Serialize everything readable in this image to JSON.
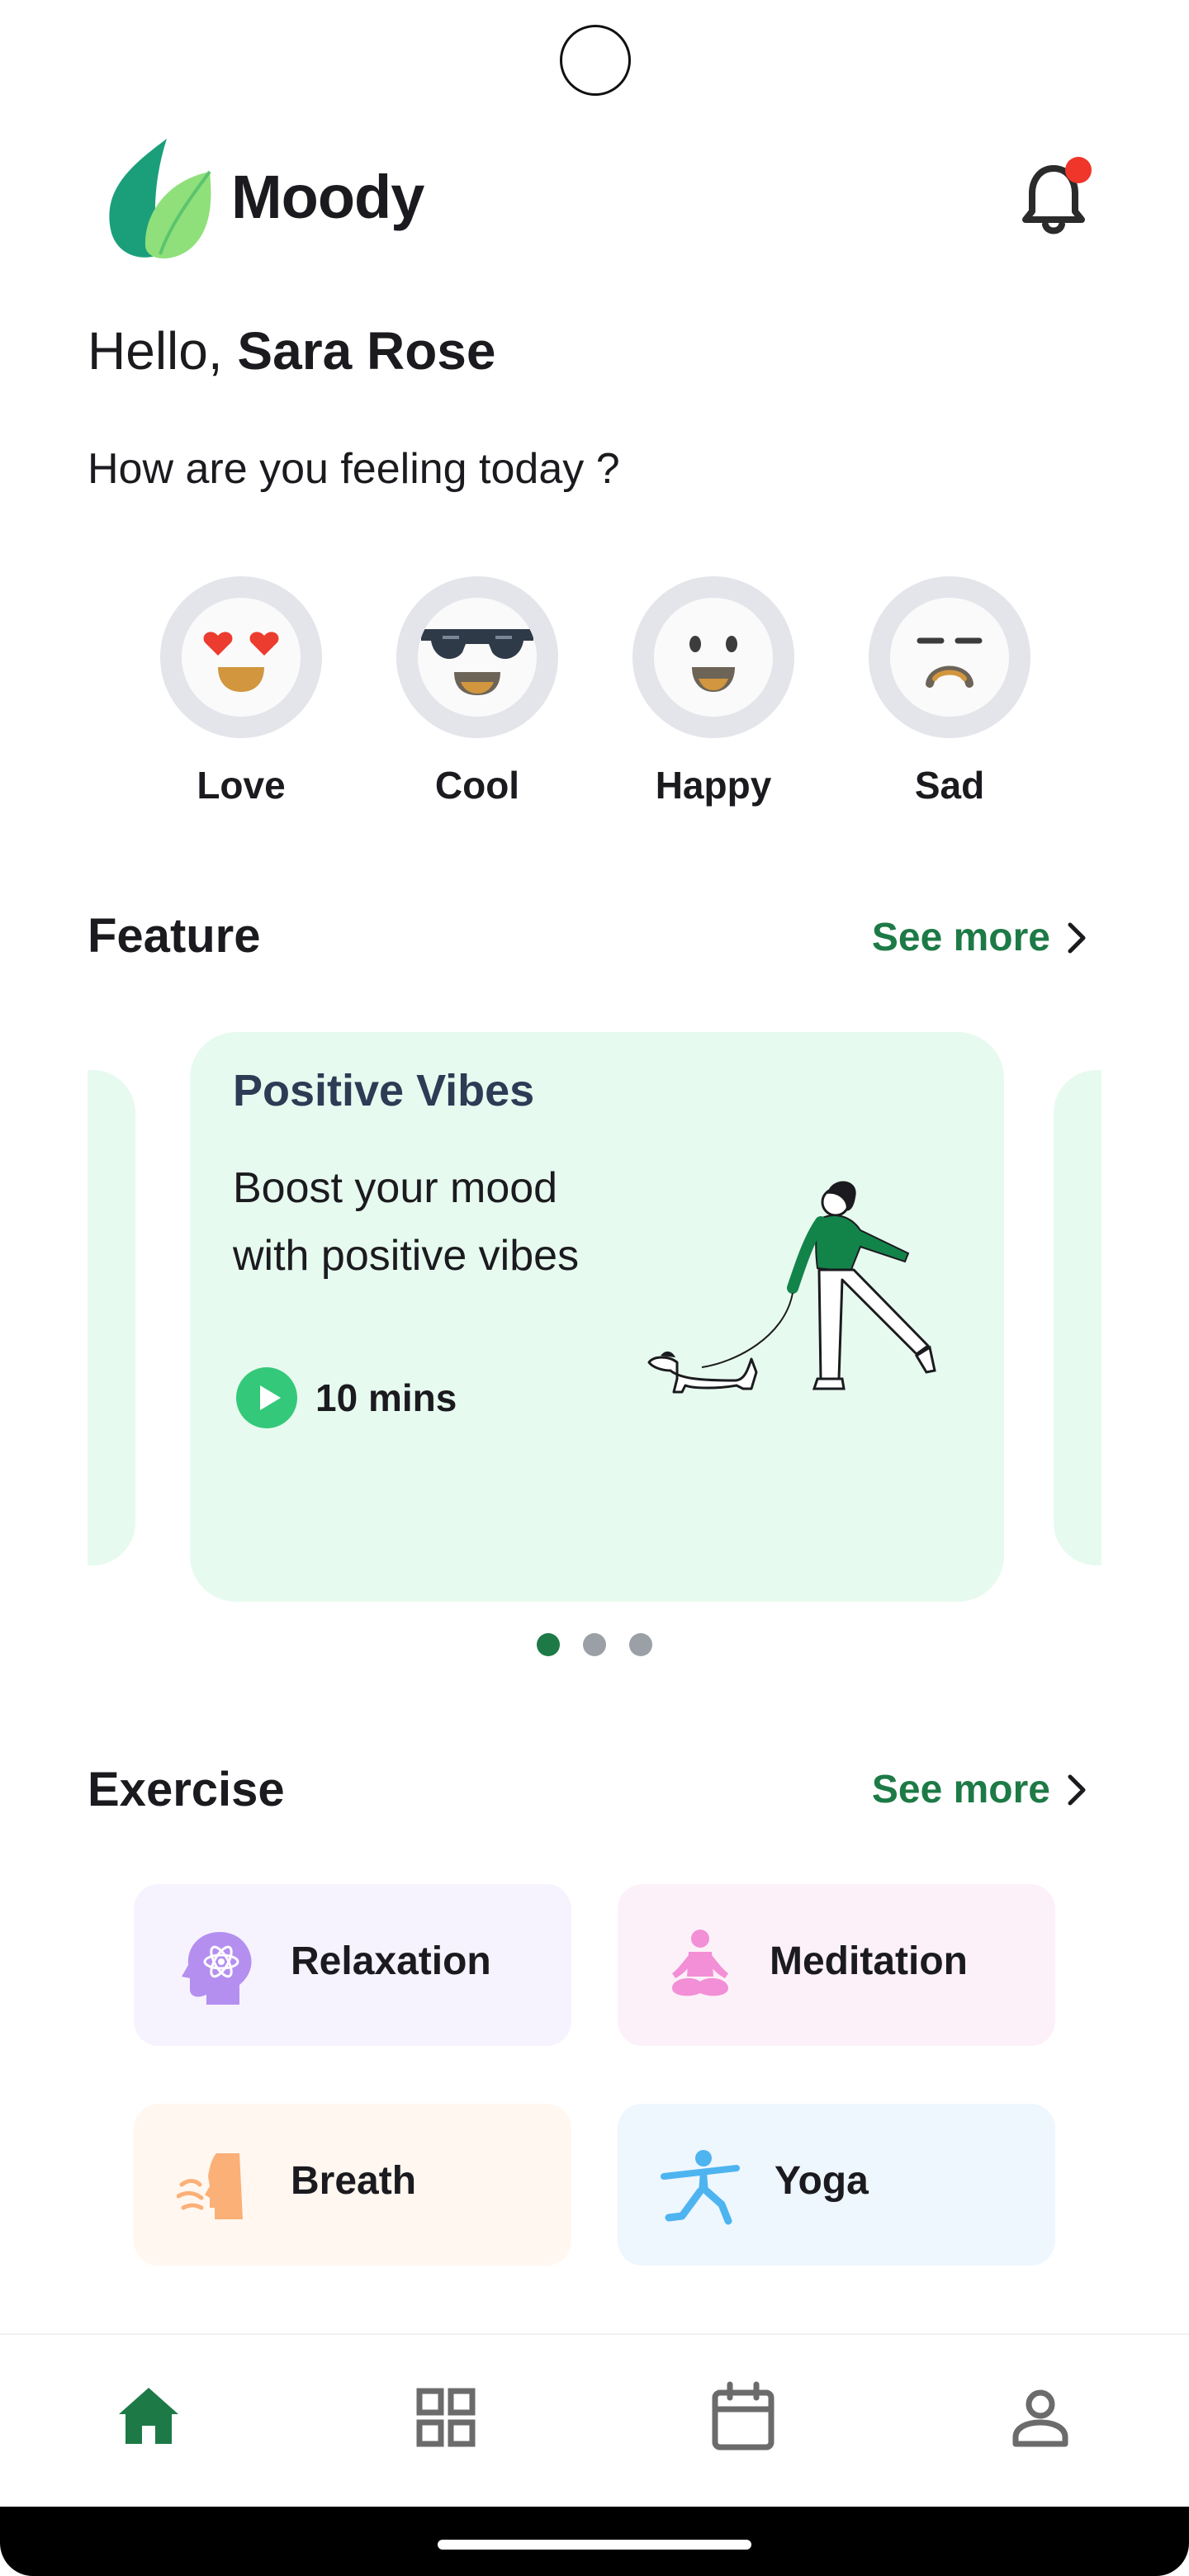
{
  "app": {
    "title": "Moody"
  },
  "greeting": {
    "prefix": "Hello, ",
    "name": "Sara Rose"
  },
  "question": "How are you feeling today ?",
  "moods": [
    {
      "label": "Love",
      "icon": "heart-eyes-emoji-icon"
    },
    {
      "label": "Cool",
      "icon": "sunglasses-emoji-icon"
    },
    {
      "label": "Happy",
      "icon": "smile-emoji-icon"
    },
    {
      "label": "Sad",
      "icon": "sad-emoji-icon"
    }
  ],
  "feature": {
    "title": "Feature",
    "see_more": "See more",
    "card": {
      "title": "Positive Vibes",
      "description": "Boost your mood with positive vibes",
      "duration": "10 mins"
    },
    "pages": 3,
    "active_page": 1
  },
  "exercise": {
    "title": "Exercise",
    "see_more": "See more",
    "items": [
      {
        "label": "Relaxation",
        "icon": "head-atom-icon",
        "bg": "#f6f3ff"
      },
      {
        "label": "Meditation",
        "icon": "meditation-pose-icon",
        "bg": "#fdf1f9"
      },
      {
        "label": "Breath",
        "icon": "breath-face-icon",
        "bg": "#fff7f0"
      },
      {
        "label": "Yoga",
        "icon": "yoga-pose-icon",
        "bg": "#eef6fe"
      }
    ]
  },
  "nav": {
    "items": [
      {
        "icon": "home-icon",
        "active": true
      },
      {
        "icon": "grid-icon",
        "active": false
      },
      {
        "icon": "calendar-icon",
        "active": false
      },
      {
        "icon": "profile-icon",
        "active": false
      }
    ]
  },
  "colors": {
    "accent": "#1d7a46",
    "card_bg": "#e7faef",
    "play": "#34c87a",
    "notification_dot": "#f0352a"
  }
}
